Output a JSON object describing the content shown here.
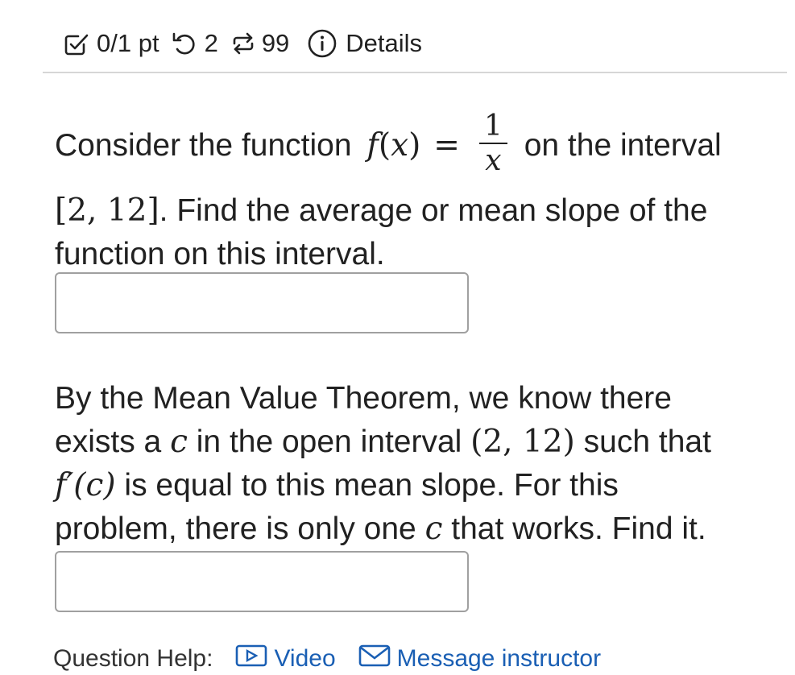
{
  "header": {
    "score": "0/1 pt",
    "retries": "2",
    "attempts": "99",
    "details_label": "Details"
  },
  "question1": {
    "text_pre": "Consider the function",
    "func_name": "f",
    "func_var": "x",
    "numerator": "1",
    "denominator": "x",
    "text_mid": "on the interval",
    "interval": "[2, 12]",
    "text_after": ". Find the average or mean slope of the",
    "text_end": "function on this interval."
  },
  "question2": {
    "line1": "By the Mean Value Theorem, we know there",
    "line2_pre": "exists a",
    "var_c": "c",
    "line2_mid": "in the open interval",
    "open_interval": "(2, 12)",
    "line2_post": "such that",
    "derivative": "f′(c)",
    "line3_post": "is equal to this mean slope. For this",
    "line4_pre": "problem, there is only one",
    "line4_post": "that works. Find it."
  },
  "answer1": {
    "value": "",
    "placeholder": ""
  },
  "answer2": {
    "value": "",
    "placeholder": ""
  },
  "help": {
    "label": "Question Help:",
    "video_label": "Video",
    "message_label": "Message instructor"
  },
  "colors": {
    "link": "#1a5fb4",
    "text": "#212121",
    "border": "#a0a0a0"
  },
  "icons": [
    "checkbox-pencil-icon",
    "retry-icon",
    "repeat-icon",
    "info-icon",
    "video-icon",
    "mail-icon"
  ]
}
